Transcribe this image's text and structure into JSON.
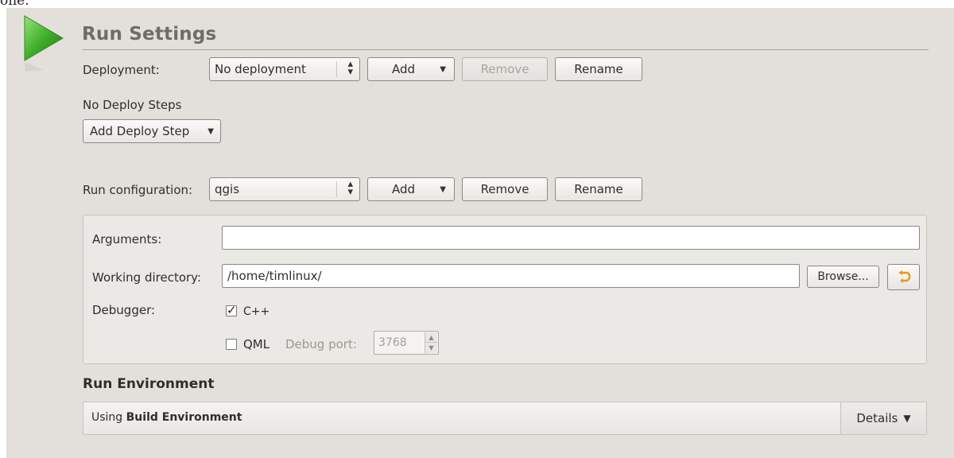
{
  "top_fragment": "one.",
  "header": {
    "title": "Run Settings"
  },
  "deployment": {
    "label": "Deployment:",
    "combo_value": "No deployment",
    "add_label": "Add",
    "remove_label": "Remove",
    "rename_label": "Rename",
    "no_steps_text": "No Deploy Steps",
    "add_step_label": "Add Deploy Step"
  },
  "run_configuration": {
    "label": "Run configuration:",
    "combo_value": "qgis",
    "add_label": "Add",
    "remove_label": "Remove",
    "rename_label": "Rename"
  },
  "details_box": {
    "arguments_label": "Arguments:",
    "arguments_value": "",
    "working_dir_label": "Working directory:",
    "working_dir_value": "/home/timlinux/",
    "browse_label": "Browse...",
    "debugger_label": "Debugger:",
    "cpp_label": "C++",
    "cpp_checked": true,
    "qml_label": "QML",
    "qml_checked": false,
    "debug_port_label": "Debug port:",
    "debug_port_value": "3768"
  },
  "run_environment": {
    "heading": "Run Environment",
    "using_prefix": "Using ",
    "using_bold": "Build Environment",
    "details_label": "Details"
  },
  "icons": {
    "run": "play-triangle-icon",
    "reset": "reset-arrow-icon",
    "colors": {
      "run_green": "#3fae2a",
      "reset_orange": "#e69a1e"
    }
  }
}
